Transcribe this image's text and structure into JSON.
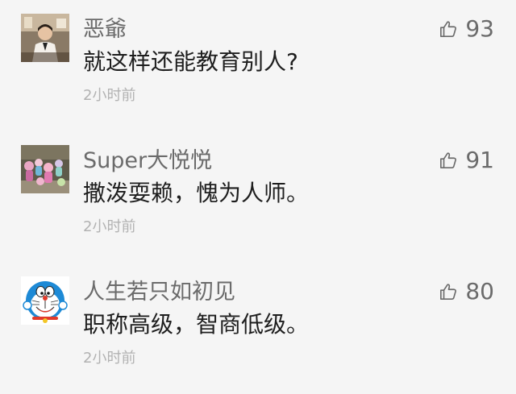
{
  "comments": [
    {
      "username": "恶爺",
      "text": "就这样还能教育别人?",
      "time": "2小时前",
      "likes": "93",
      "avatar_icon": "man-portrait-avatar"
    },
    {
      "username": "Super大悦悦",
      "text": "撒泼耍赖，愧为人师。",
      "time": "2小时前",
      "likes": "91",
      "avatar_icon": "toy-figures-avatar"
    },
    {
      "username": "人生若只如初见",
      "text": "职称高级，智商低级。",
      "time": "2小时前",
      "likes": "80",
      "avatar_icon": "doraemon-avatar"
    }
  ],
  "colors": {
    "background": "#f5f5f5",
    "username": "#6b6b6b",
    "text": "#1e1e1e",
    "time": "#b2b2b2",
    "like": "#6b6b6b"
  }
}
